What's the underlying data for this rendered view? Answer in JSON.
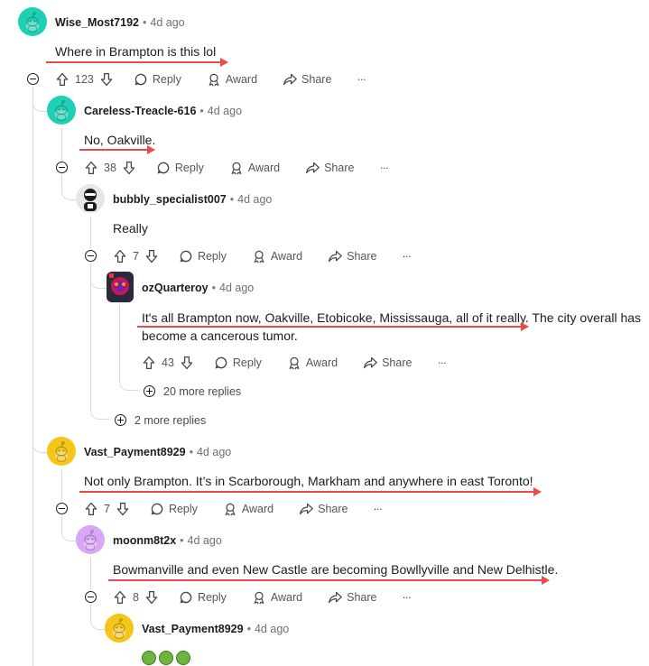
{
  "comments": {
    "c1": {
      "username": "Wise_Most7192",
      "time": "4d ago",
      "body": "Where in Brampton is this lol",
      "votes": "123"
    },
    "c2": {
      "username": "Careless-Treacle-616",
      "time": "4d ago",
      "body": "No, Oakville.",
      "votes": "38"
    },
    "c3": {
      "username": "bubbly_specialist007",
      "time": "4d ago",
      "body": "Really",
      "votes": "7"
    },
    "c4": {
      "username": "ozQuarteroy",
      "time": "4d ago",
      "body_line1": "It's all Brampton now, Oakville, Etobicoke, Mississauga, all of it really. The city overall has",
      "body_line2": "become a cancerous tumor.",
      "votes": "43"
    },
    "c5": {
      "username": "Vast_Payment8929",
      "time": "4d ago",
      "body": "Not only Brampton. It’s in Scarborough, Markham and anywhere in east Toronto!",
      "votes": "7"
    },
    "c6": {
      "username": "moonm8t2x",
      "time": "4d ago",
      "body": "Bowmanville and even New Castle are becoming Bowllyville and New Delhistle.",
      "votes": "8"
    },
    "c7": {
      "username": "Vast_Payment8929",
      "time": "4d ago"
    }
  },
  "labels": {
    "reply": "Reply",
    "award": "Award",
    "share": "Share",
    "more": "···",
    "separator": "•",
    "more_replies_20": "20 more replies",
    "more_replies_2": "2 more replies"
  },
  "icons": [
    "upvote-icon",
    "downvote-icon",
    "reply-icon",
    "award-icon",
    "share-icon",
    "more-options-icon",
    "collapse-icon",
    "expand-icon",
    "snoo-avatar-icon",
    "nauseated-face-emoji"
  ],
  "colors": {
    "annotation_arrow": "#ec4b4b",
    "thread_line": "#dcdcdc",
    "avatar_teal": "#1fd1b4",
    "avatar_yellow": "#f5c518",
    "avatar_purple": "#d9a5f7"
  }
}
